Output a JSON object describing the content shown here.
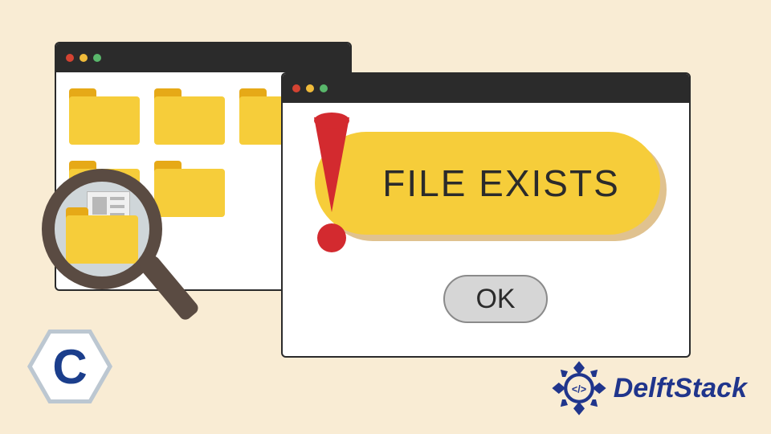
{
  "dialog": {
    "message": "FILE EXISTS",
    "ok_label": "OK"
  },
  "logos": {
    "c_letter": "C",
    "delft_text": "DelftStack",
    "delft_code": "</>"
  },
  "icons": {
    "exclamation": "exclamation-icon",
    "magnifier": "magnifier-icon",
    "folder": "folder-icon"
  }
}
